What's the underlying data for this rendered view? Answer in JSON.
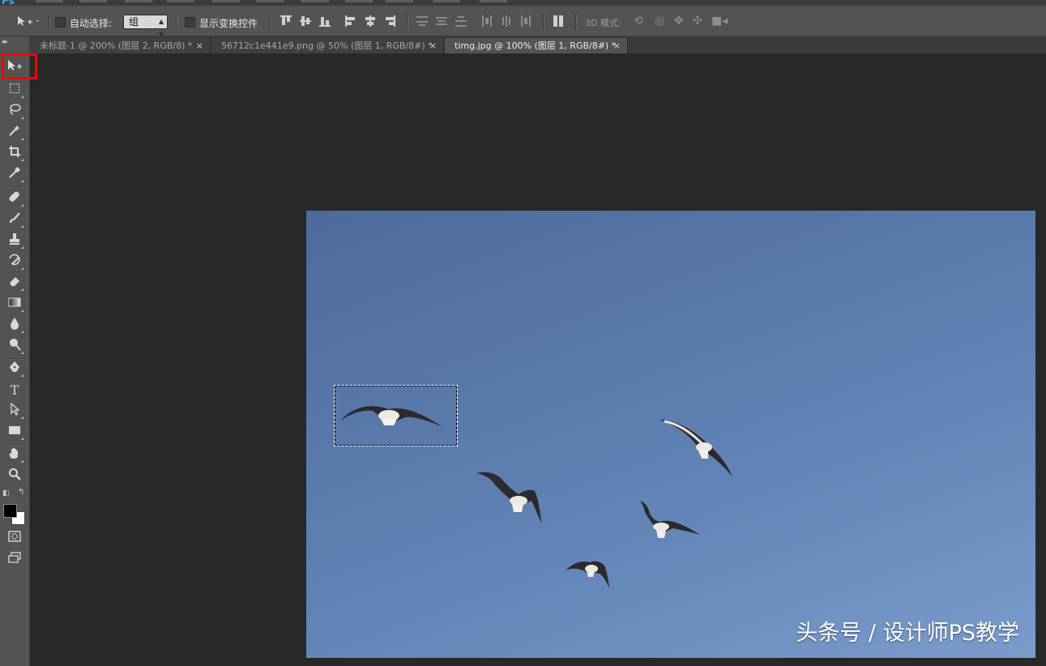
{
  "app": {
    "logo": "Ps"
  },
  "options_bar": {
    "auto_select_label": "自动选择:",
    "auto_select_target": "组",
    "show_transform_label": "显示变换控件",
    "mode_3d_label": "3D 模式:"
  },
  "tabs": [
    {
      "label": "未标题-1 @ 200% (图层 2, RGB/8) *",
      "close": "×",
      "active": false
    },
    {
      "label": "56712c1e441e9.png @ 50% (图层 1, RGB/8#) *",
      "close": "×",
      "active": false
    },
    {
      "label": "timg.jpg @ 100% (图层 1, RGB/8#) *",
      "close": "×",
      "active": true
    }
  ],
  "tools": {
    "move": "move-tool",
    "marquee": "rect-marquee-tool",
    "lasso": "lasso-tool",
    "magic_wand": "magic-wand-tool",
    "crop": "crop-tool",
    "eyedropper": "eyedropper-tool",
    "text_glyph": "T"
  },
  "colors": {
    "foreground": "#000000",
    "background": "#ffffff",
    "highlight": "#ff0000",
    "sky": "#5877a8"
  },
  "canvas": {
    "watermark": "头条号 / 设计师PS教学"
  }
}
